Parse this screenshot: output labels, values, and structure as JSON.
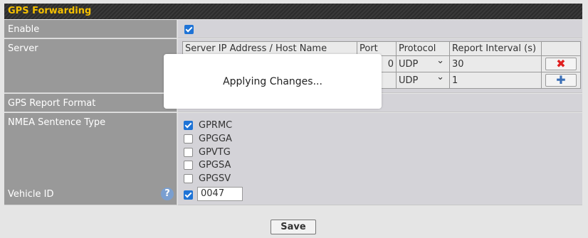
{
  "section": {
    "title": "GPS Forwarding"
  },
  "enable": {
    "label": "Enable",
    "checked": true
  },
  "server": {
    "label": "Server",
    "headers": [
      "Server IP Address / Host Name",
      "Port",
      "Protocol",
      "Report Interval (s)"
    ],
    "rows": [
      {
        "host": "",
        "port": "0",
        "protocol": "UDP",
        "interval": "30",
        "action_icon": "delete-icon"
      },
      {
        "host": "",
        "port": "",
        "protocol": "UDP",
        "interval": "1",
        "action_icon": "add-icon"
      }
    ]
  },
  "report_format": {
    "label": "GPS Report Format"
  },
  "nmea": {
    "label": "NMEA Sentence Type",
    "options": [
      {
        "name": "GPRMC",
        "checked": true
      },
      {
        "name": "GPGGA",
        "checked": false
      },
      {
        "name": "GPVTG",
        "checked": false
      },
      {
        "name": "GPGSA",
        "checked": false
      },
      {
        "name": "GPGSV",
        "checked": false
      }
    ]
  },
  "vehicle": {
    "label": "Vehicle ID",
    "help_icon": "help-icon",
    "checked": true,
    "value": "0047"
  },
  "overlay": {
    "message": "Applying Changes..."
  },
  "save_label": "Save",
  "colors": {
    "header_text": "#f5c000",
    "label_bg": "#999999",
    "value_bg": "#d4d3d8",
    "delete": "#e02020",
    "add": "#3b6fb6"
  }
}
